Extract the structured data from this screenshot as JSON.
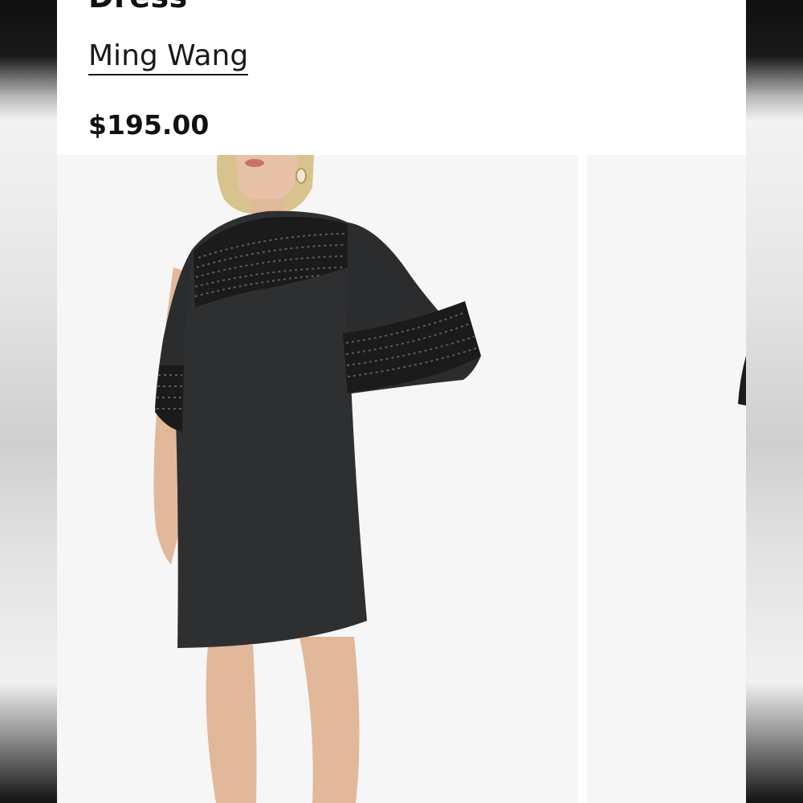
{
  "product": {
    "title": "Dress",
    "brand": "Ming Wang",
    "price": "$195.00"
  },
  "gallery": {
    "images": [
      {
        "alt": "black-dress-front"
      },
      {
        "alt": "black-dress-next"
      }
    ]
  },
  "colors": {
    "dress": "#2e2f31",
    "lace": "#1b1b1b",
    "skin": "#e2b89a",
    "hair": "#d8c28e",
    "photo_bg": "#f6f6f6"
  }
}
